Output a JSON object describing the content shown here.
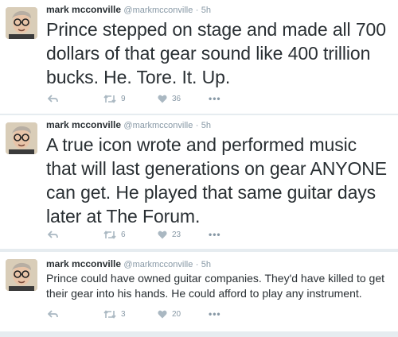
{
  "tweets": [
    {
      "name": "mark mcconville",
      "handle": "@markmcconville",
      "separator": "·",
      "time": "5h",
      "text": "Prince stepped on stage and made all 700 dollars of that gear sound like 400 trillion bucks. He. Tore. It. Up.",
      "retweets": "9",
      "likes": "36"
    },
    {
      "name": "mark mcconville",
      "handle": "@markmcconville",
      "separator": "·",
      "time": "5h",
      "text": "A true icon wrote and performed music that will last generations on gear ANYONE can get. He played that same guitar days later at The Forum.",
      "retweets": "6",
      "likes": "23"
    },
    {
      "name": "mark mcconville",
      "handle": "@markmcconville",
      "separator": "·",
      "time": "5h",
      "text": "Prince could have owned guitar companies. They'd have killed to get their gear into his hands. He could afford to play any instrument.",
      "retweets": "3",
      "likes": "20"
    }
  ],
  "icons": {
    "reply": "reply-arrow-icon",
    "retweet": "retweet-icon",
    "like": "heart-icon",
    "more": "more-dots-icon"
  },
  "colors": {
    "text": "#292f33",
    "muted": "#8899a6",
    "background": "#e6ecf0",
    "icon": "#aab8c2"
  },
  "more_label": "•••"
}
